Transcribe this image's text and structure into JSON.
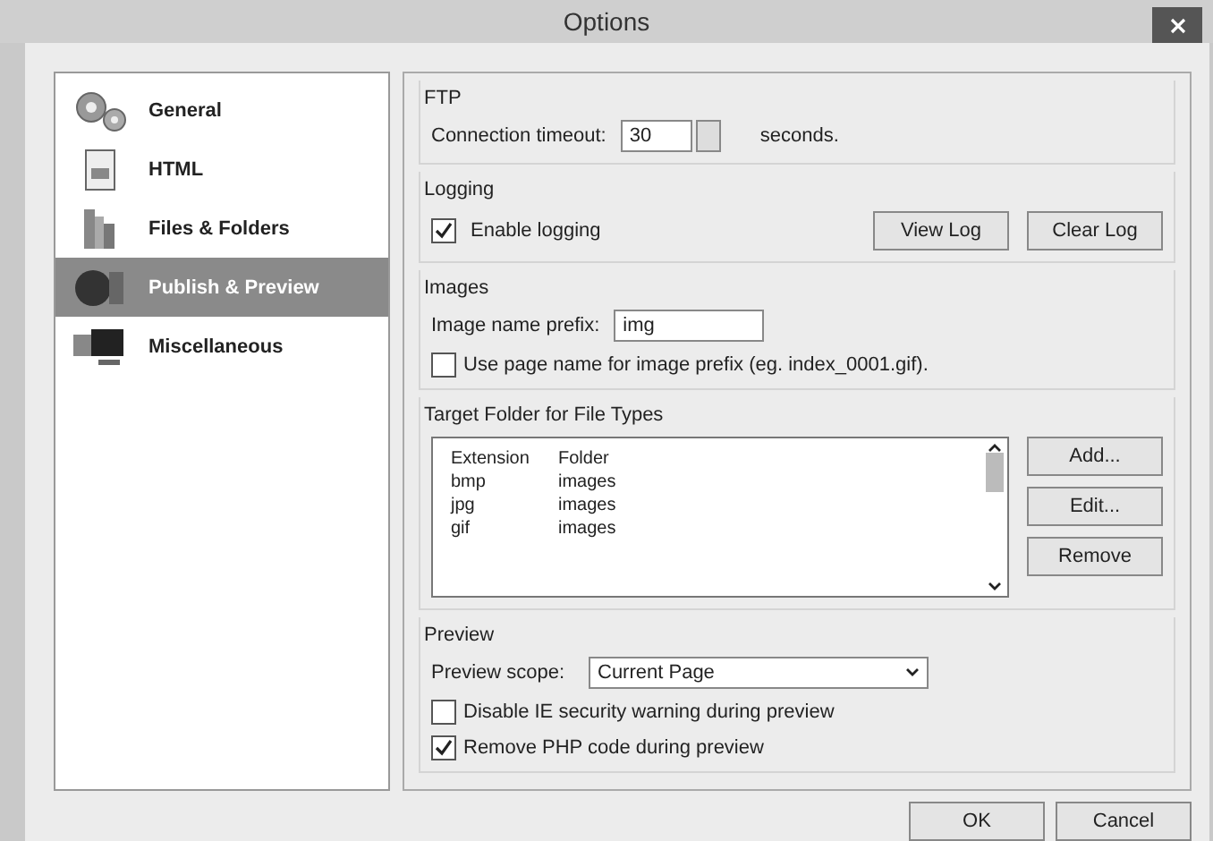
{
  "window": {
    "title": "Options"
  },
  "sidebar": {
    "items": [
      {
        "label": "General",
        "selected": false
      },
      {
        "label": "HTML",
        "selected": false
      },
      {
        "label": "Files & Folders",
        "selected": false
      },
      {
        "label": "Publish & Preview",
        "selected": true
      },
      {
        "label": "Miscellaneous",
        "selected": false
      }
    ]
  },
  "ftp": {
    "title": "FTP",
    "timeout_label": "Connection timeout:",
    "timeout_value": "30",
    "unit": "seconds."
  },
  "logging": {
    "title": "Logging",
    "enable": {
      "label": "Enable logging",
      "checked": true
    },
    "buttons": [
      "View Log",
      "Clear Log"
    ]
  },
  "images": {
    "title": "Images",
    "prefix_label": "Image name prefix:",
    "prefix_value": "img",
    "use_page_name": {
      "label": "Use page name for image prefix (eg. index_0001.gif).",
      "checked": false
    }
  },
  "target_folder": {
    "title": "Target Folder for File Types",
    "columns": [
      "Extension",
      "Folder"
    ],
    "rows": [
      [
        "bmp",
        "images"
      ],
      [
        "jpg",
        "images"
      ],
      [
        "gif",
        "images"
      ]
    ],
    "buttons": [
      "Add...",
      "Edit...",
      "Remove"
    ]
  },
  "preview": {
    "title": "Preview",
    "scope_label": "Preview scope:",
    "scope_value": "Current Page",
    "options": [
      {
        "label": "Disable IE security warning during preview",
        "checked": false
      },
      {
        "label": "Remove PHP code during preview",
        "checked": true
      }
    ]
  },
  "buttons": [
    "OK",
    "Cancel"
  ]
}
